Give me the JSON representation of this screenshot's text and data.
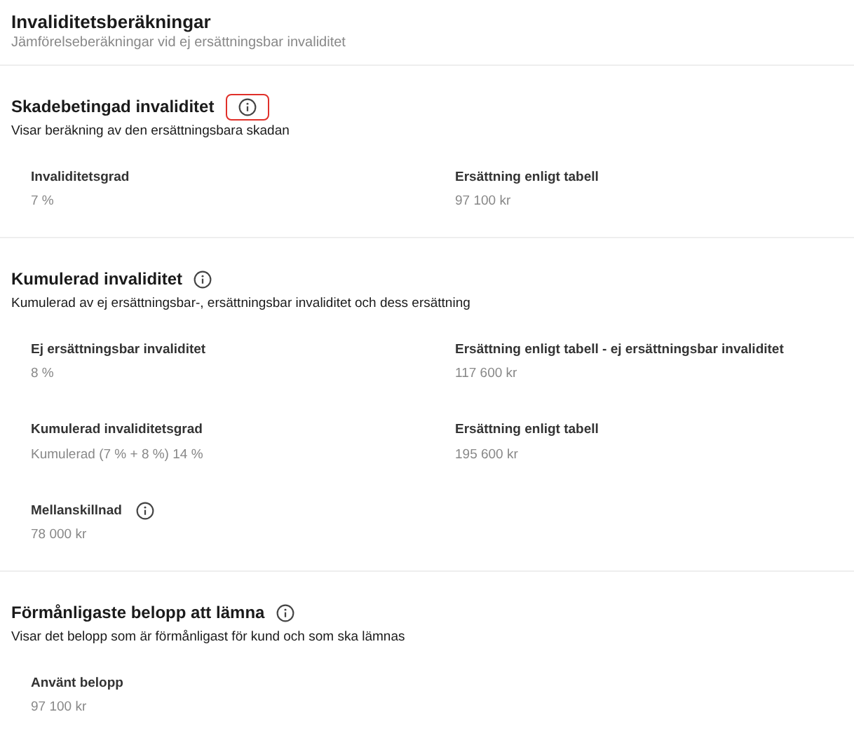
{
  "header": {
    "title": "Invaliditetsberäkningar",
    "subtitle": "Jämförelseberäkningar vid ej ersättningsbar invaliditet"
  },
  "sections": [
    {
      "title": "Skadebetingad invaliditet",
      "info_highlighted": true,
      "description": "Visar beräkning av den ersättningsbara skadan",
      "fields": [
        {
          "label": "Invaliditetsgrad",
          "value": "7 %",
          "info": false
        },
        {
          "label": "Ersättning enligt tabell",
          "value": "97 100 kr",
          "info": false
        }
      ]
    },
    {
      "title": "Kumulerad invaliditet",
      "info_highlighted": false,
      "description": "Kumulerad av ej ersättningsbar-, ersättningsbar invaliditet och dess ersättning",
      "fields": [
        {
          "label": "Ej ersättningsbar invaliditet",
          "value": "8 %",
          "info": false
        },
        {
          "label": "Ersättning enligt tabell - ej ersättningsbar invaliditet",
          "value": "117 600 kr",
          "info": false
        },
        {
          "label": "Kumulerad invaliditetsgrad",
          "value": "Kumulerad (7 % + 8 %) 14 %",
          "info": false
        },
        {
          "label": "Ersättning enligt tabell",
          "value": "195 600 kr",
          "info": false
        },
        {
          "label": "Mellanskillnad",
          "value": "78 000 kr",
          "info": true
        }
      ]
    },
    {
      "title": "Förmånligaste belopp att lämna",
      "info_highlighted": false,
      "description": "Visar det belopp som är förmånligast för kund och som ska lämnas",
      "fields": [
        {
          "label": "Använt belopp",
          "value": "97 100 kr",
          "info": false
        }
      ]
    }
  ]
}
